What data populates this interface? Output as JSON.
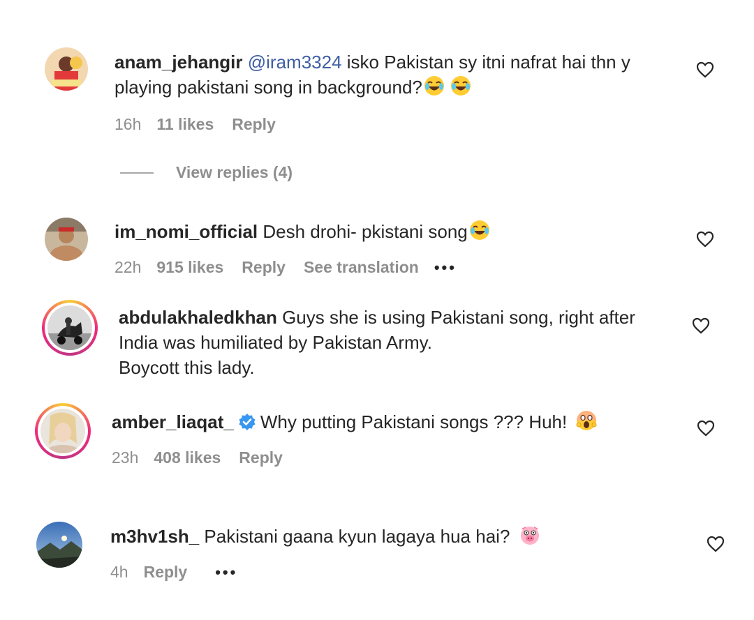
{
  "comments": [
    {
      "username": "anam_jehangir",
      "mention": "@iram3324",
      "text_line1": " isko Pakistan sy itni nafrat hai thn y",
      "text_line2": "playing pakistani song in background?",
      "time": "16h",
      "likes": "11 likes",
      "reply": "Reply",
      "emoji": "face-with-tears-of-joy"
    },
    {
      "username": "im_nomi_official",
      "text_line1": " Desh drohi- pkistani song",
      "time": "22h",
      "likes": "915 likes",
      "reply": "Reply",
      "see_translation": "See translation",
      "more": "•••",
      "emoji": "face-with-tears-of-joy"
    },
    {
      "username": "abdulakhaledkhan",
      "text_line1": " Guys she is using Pakistani song, right after",
      "text_line2": "India was humiliated by Pakistan Army.",
      "text_line3": "Boycott this lady."
    },
    {
      "username": "amber_liaqat_",
      "verified": true,
      "text_line1": "Why putting Pakistani songs ??? Huh! ",
      "time": "23h",
      "likes": "408 likes",
      "reply": "Reply",
      "emoji": "face-screaming"
    },
    {
      "username": "m3hv1sh_",
      "text_line1": " Pakistani gaana kyun lagaya hua hai? ",
      "time": "4h",
      "reply": "Reply",
      "more": "•••",
      "emoji": "pig-face"
    }
  ],
  "view_replies": "View replies (4)",
  "colors": {
    "mention": "#3d5ea3",
    "meta": "#8e8e8e",
    "text": "#262626"
  }
}
